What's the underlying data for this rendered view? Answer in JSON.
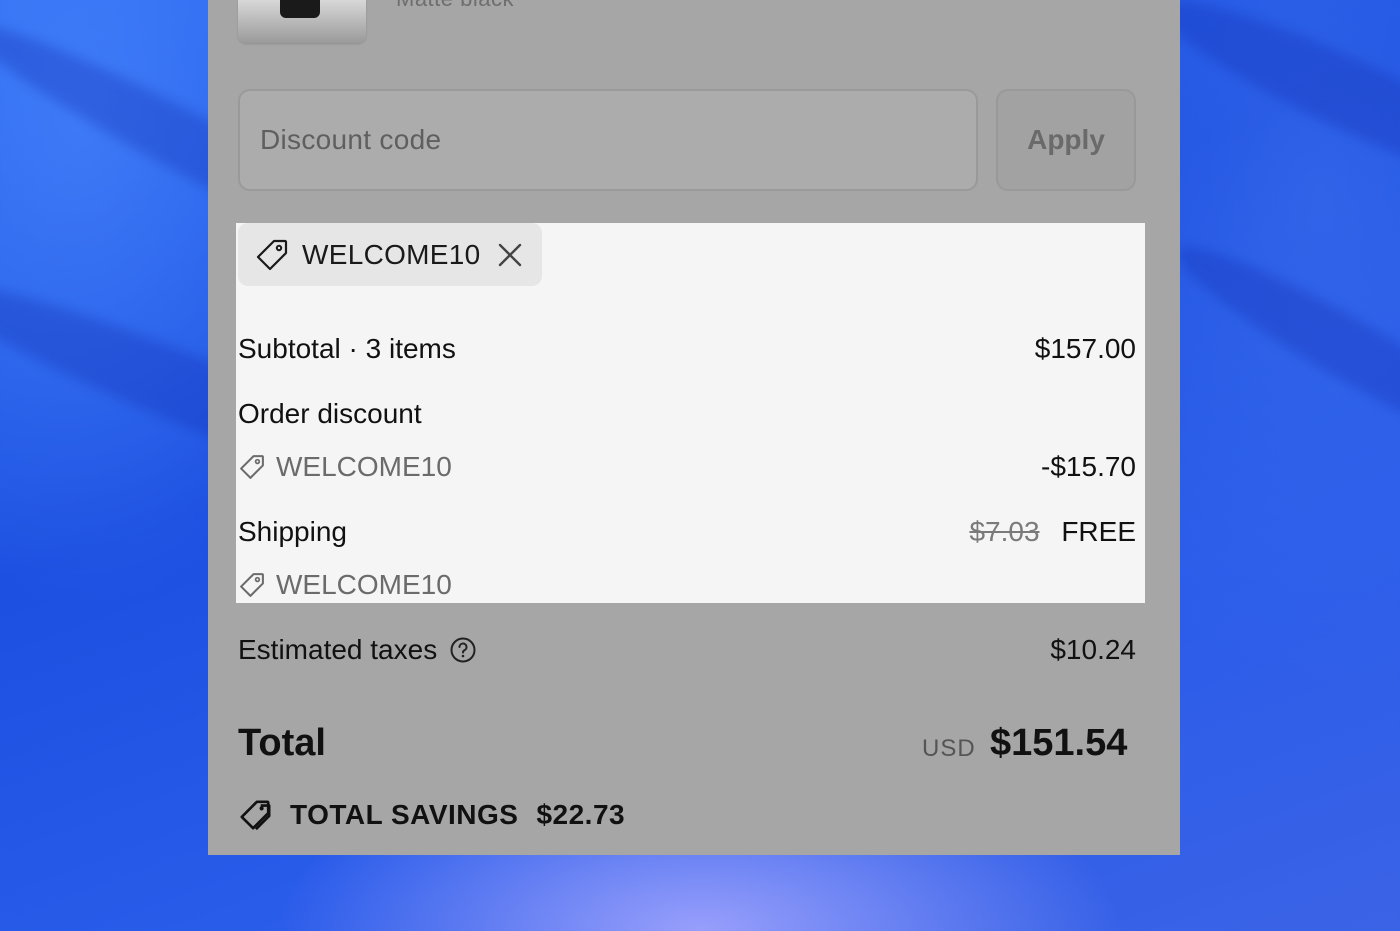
{
  "product": {
    "variant": "Matte black"
  },
  "discount": {
    "placeholder": "Discount code",
    "apply_label": "Apply"
  },
  "applied_code": {
    "code": "WELCOME10",
    "remove_icon": "close-icon",
    "tag_icon": "tag-icon"
  },
  "summary": {
    "subtotal_label": "Subtotal · 3 items",
    "subtotal_value": "$157.00",
    "order_discount_label": "Order discount",
    "order_discount_code": "WELCOME10",
    "order_discount_value": "-$15.70",
    "shipping_label": "Shipping",
    "shipping_original": "$7.03",
    "shipping_value": "FREE",
    "shipping_code": "WELCOME10",
    "taxes_label": "Estimated taxes",
    "taxes_value": "$10.24"
  },
  "total": {
    "label": "Total",
    "currency": "USD",
    "value": "$151.54"
  },
  "savings": {
    "label": "TOTAL SAVINGS",
    "value": "$22.73"
  },
  "colors": {
    "background_blue": "#1c4fe0",
    "panel_overlay": "#a6a6a6",
    "highlight": "#f5f5f5"
  }
}
